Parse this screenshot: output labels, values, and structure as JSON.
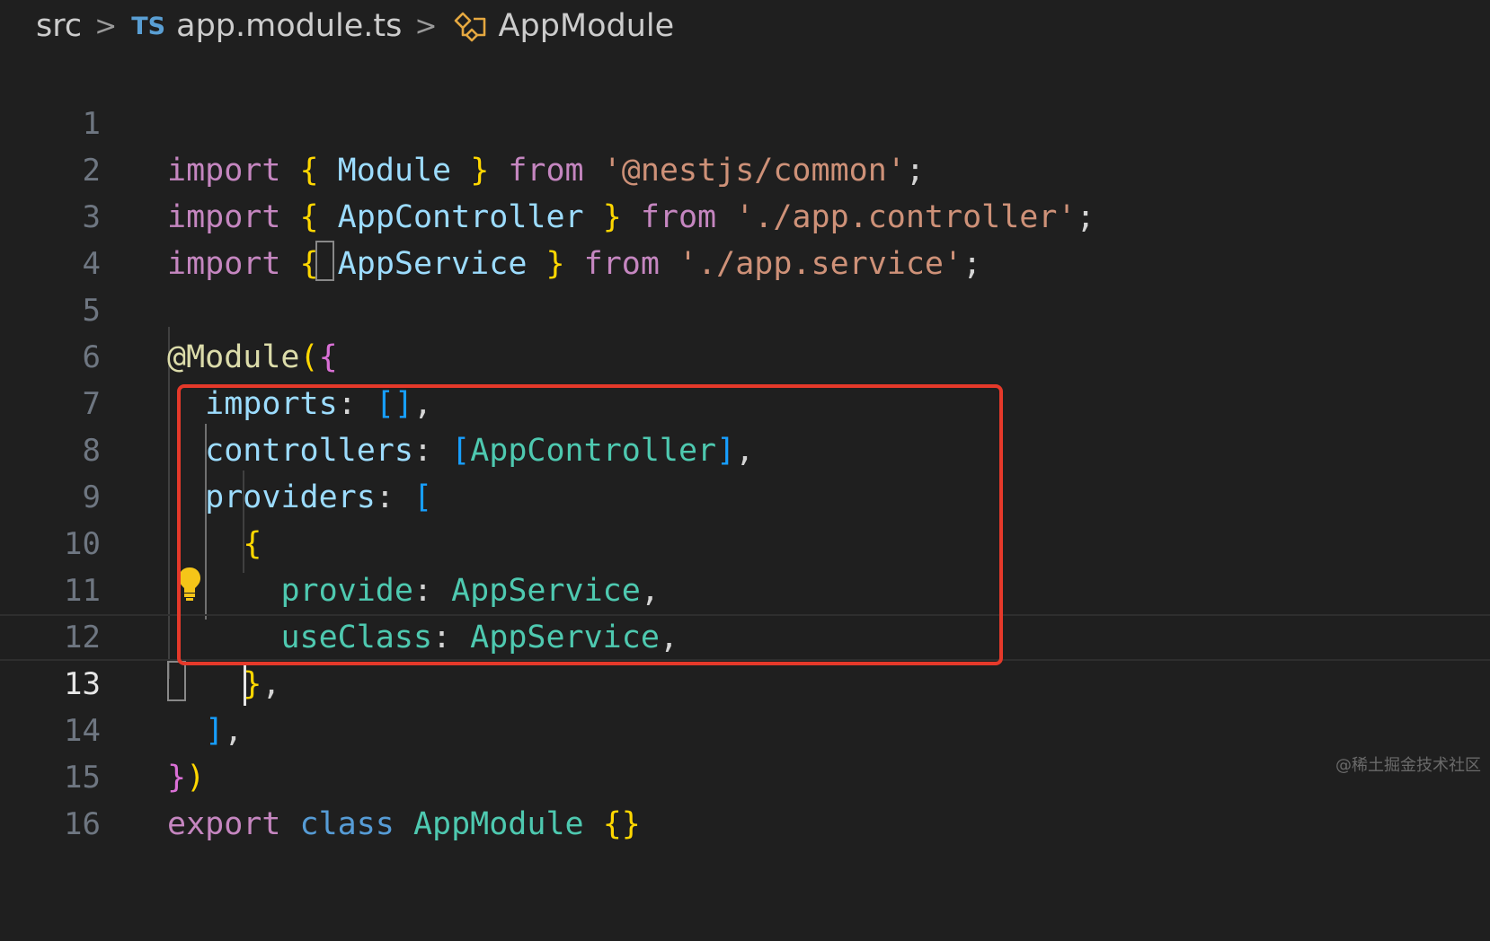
{
  "breadcrumb": {
    "folder": "src",
    "file_icon_label": "TS",
    "file": "app.module.ts",
    "symbol": "AppModule",
    "separator": ">"
  },
  "editor": {
    "language": "typescript",
    "current_line": 13,
    "lines": [
      {
        "n": "1",
        "text": "import { Module } from '@nestjs/common';"
      },
      {
        "n": "2",
        "text": "import { AppController } from './app.controller';"
      },
      {
        "n": "3",
        "text": "import { AppService } from './app.service';"
      },
      {
        "n": "4",
        "text": ""
      },
      {
        "n": "5",
        "text": "@Module({"
      },
      {
        "n": "6",
        "text": "  imports: [],"
      },
      {
        "n": "7",
        "text": "  controllers: [AppController],"
      },
      {
        "n": "8",
        "text": "  providers: ["
      },
      {
        "n": "9",
        "text": "    {"
      },
      {
        "n": "10",
        "text": "      provide: AppService,"
      },
      {
        "n": "11",
        "text": "      useClass: AppService,"
      },
      {
        "n": "12",
        "text": "    },"
      },
      {
        "n": "13",
        "text": "  ],"
      },
      {
        "n": "14",
        "text": "})"
      },
      {
        "n": "15",
        "text": "export class AppModule {}"
      },
      {
        "n": "16",
        "text": ""
      }
    ]
  },
  "annotation": {
    "color": "#e5392a"
  },
  "watermark": "@稀土掘金技术社区",
  "colors": {
    "background": "#1f1f1f",
    "keyword": "#c586c0",
    "storage": "#569cd6",
    "bracket_gold": "#ffd700",
    "bracket_pink": "#da70d6",
    "bracket_blue": "#179fff",
    "identifier": "#9cdcfe",
    "class": "#4ec9b0",
    "string": "#ce9178",
    "decorator": "#dcdcaa"
  },
  "icons": [
    "typescript-file-icon",
    "module-symbol-icon",
    "lightbulb-icon",
    "chevron-right-icon"
  ]
}
